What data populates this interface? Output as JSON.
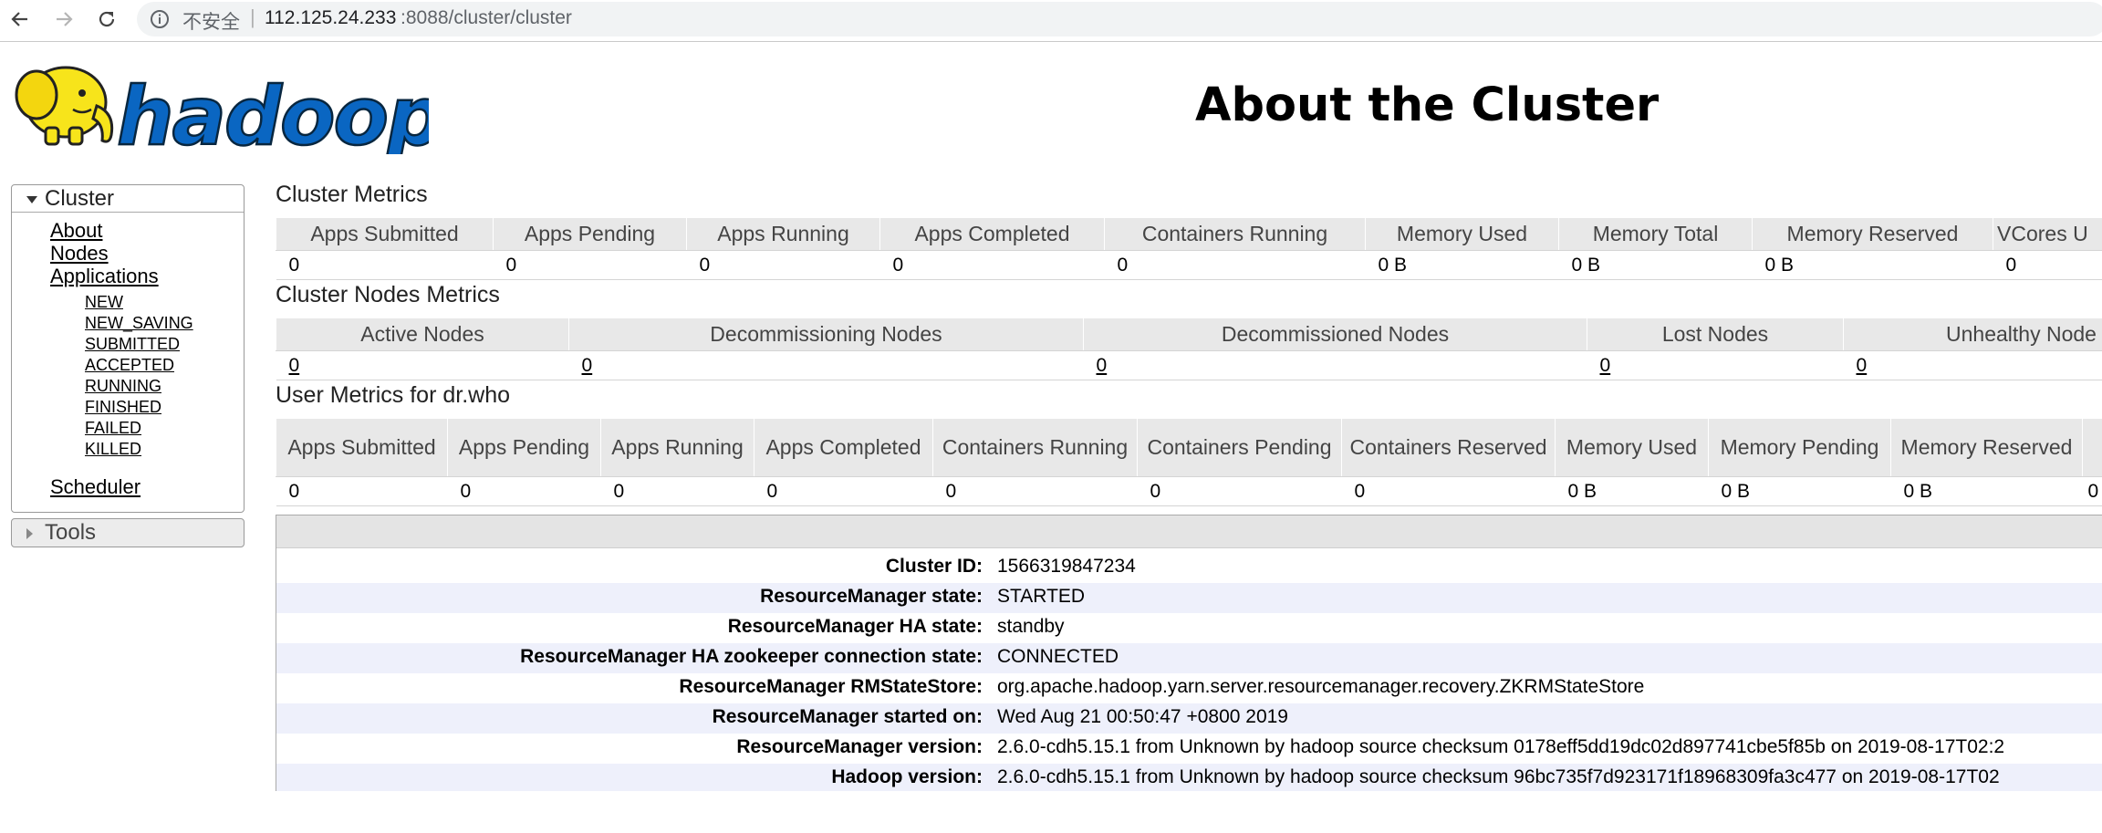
{
  "browser": {
    "security_label": "不安全",
    "separator": "|",
    "url_host": "112.125.24.233",
    "url_path": ":8088/cluster/cluster"
  },
  "header": {
    "logo_text": "hadoop",
    "title": "About the Cluster"
  },
  "nav": {
    "cluster_label": "Cluster",
    "about": "About",
    "nodes": "Nodes",
    "applications": "Applications",
    "states": [
      "NEW",
      "NEW_SAVING",
      "SUBMITTED",
      "ACCEPTED",
      "RUNNING",
      "FINISHED",
      "FAILED",
      "KILLED"
    ],
    "scheduler": "Scheduler",
    "tools_label": "Tools"
  },
  "cluster_metrics": {
    "title": "Cluster Metrics",
    "headers": [
      "Apps Submitted",
      "Apps Pending",
      "Apps Running",
      "Apps Completed",
      "Containers Running",
      "Memory Used",
      "Memory Total",
      "Memory Reserved",
      "VCores U"
    ],
    "values": [
      "0",
      "0",
      "0",
      "0",
      "0",
      "0 B",
      "0 B",
      "0 B",
      "0"
    ]
  },
  "node_metrics": {
    "title": "Cluster Nodes Metrics",
    "headers": [
      "Active Nodes",
      "Decommissioning Nodes",
      "Decommissioned Nodes",
      "Lost Nodes",
      "Unhealthy Node"
    ],
    "values": [
      "0",
      "0",
      "0",
      "0",
      "0"
    ]
  },
  "user_metrics": {
    "title": "User Metrics for dr.who",
    "headers": [
      "Apps Submitted",
      "Apps Pending",
      "Apps Running",
      "Apps Completed",
      "Containers Running",
      "Containers Pending",
      "Containers Reserved",
      "Memory Used",
      "Memory Pending",
      "Memory Reserved",
      ""
    ],
    "values": [
      "0",
      "0",
      "0",
      "0",
      "0",
      "0",
      "0",
      "0 B",
      "0 B",
      "0 B",
      "0"
    ]
  },
  "cluster_info": [
    {
      "label": "Cluster ID:",
      "value": "1566319847234"
    },
    {
      "label": "ResourceManager state:",
      "value": "STARTED"
    },
    {
      "label": "ResourceManager HA state:",
      "value": "standby"
    },
    {
      "label": "ResourceManager HA zookeeper connection state:",
      "value": "CONNECTED"
    },
    {
      "label": "ResourceManager RMStateStore:",
      "value": "org.apache.hadoop.yarn.server.resourcemanager.recovery.ZKRMStateStore"
    },
    {
      "label": "ResourceManager started on:",
      "value": "Wed Aug 21 00:50:47 +0800 2019"
    },
    {
      "label": "ResourceManager version:",
      "value": "2.6.0-cdh5.15.1 from Unknown by hadoop source checksum 0178eff5dd19dc02d897741cbe5f85b on 2019-08-17T02:2"
    },
    {
      "label": "Hadoop version:",
      "value": "2.6.0-cdh5.15.1 from Unknown by hadoop source checksum 96bc735f7d923171f18968309fa3c477 on 2019-08-17T02"
    }
  ],
  "colors": {
    "logo_blue": "#0a66c2",
    "elephant_yellow": "#f7e41b",
    "table_header_bg": "#e8e8e8",
    "info_alt_row": "#eef0fb"
  }
}
